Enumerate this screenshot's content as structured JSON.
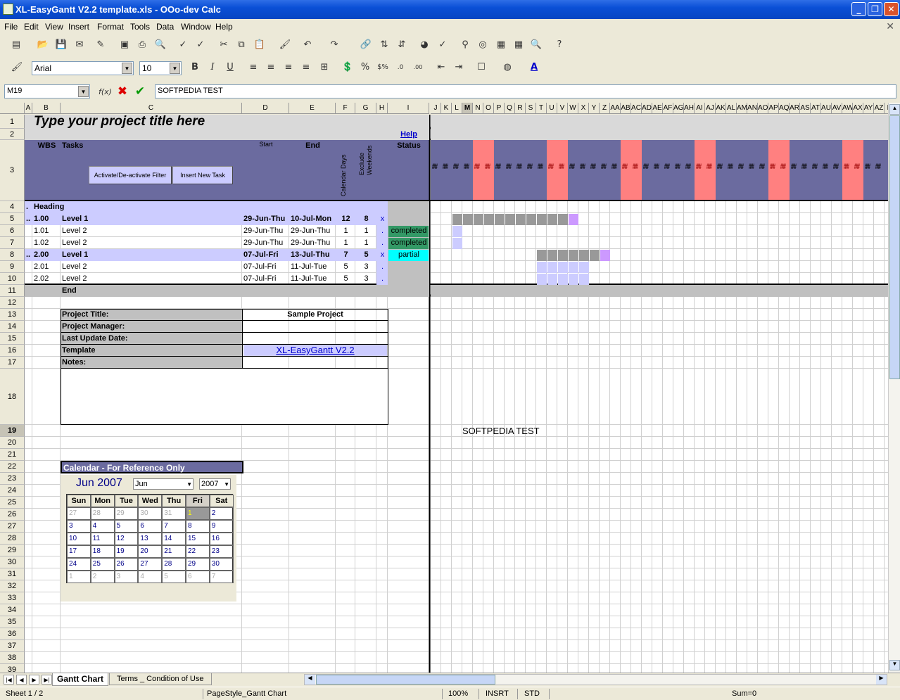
{
  "window": {
    "title": "XL-EasyGantt V2.2 template.xls - OOo-dev Calc"
  },
  "menu": [
    "File",
    "Edit",
    "View",
    "Insert",
    "Format",
    "Tools",
    "Data",
    "Window",
    "Help"
  ],
  "format_bar": {
    "font": "Arial",
    "size": "10"
  },
  "formula": {
    "name_box": "M19",
    "content": "SOFTPEDIA TEST"
  },
  "sheet": {
    "title": "Type your project title here",
    "help": "Help",
    "headers": {
      "wbs": "WBS",
      "tasks": "Tasks",
      "start": "Start",
      "end": "End",
      "calendar_days": "Calendar Days",
      "exclude_weekends": "Exclude Weekends",
      "status": "Status"
    },
    "buttons": {
      "filter": "Activate/De-activate Filter",
      "new_task": "Insert New Task"
    },
    "rows": [
      {
        "a": ".",
        "b": "Heading",
        "c": "",
        "d": "",
        "e": "",
        "f": "",
        "g": "",
        "h": "",
        "i": "",
        "kind": "heading"
      },
      {
        "a": "..",
        "b": "1.00",
        "c": "Level 1",
        "d": "29-Jun-Thu",
        "e": "10-Jul-Mon",
        "f": "12",
        "g": "8",
        "h": "x",
        "i": "",
        "kind": "level1"
      },
      {
        "a": "",
        "b": "1.01",
        "c": "Level 2",
        "d": "29-Jun-Thu",
        "e": "29-Jun-Thu",
        "f": "1",
        "g": "1",
        "h": ".",
        "i": "completed",
        "kind": "level2"
      },
      {
        "a": "",
        "b": "1.02",
        "c": "Level 2",
        "d": "29-Jun-Thu",
        "e": "29-Jun-Thu",
        "f": "1",
        "g": "1",
        "h": ".",
        "i": "completed",
        "kind": "level2"
      },
      {
        "a": "..",
        "b": "2.00",
        "c": "Level 1",
        "d": "07-Jul-Fri",
        "e": "13-Jul-Thu",
        "f": "7",
        "g": "5",
        "h": "x",
        "i": "partial",
        "kind": "level1"
      },
      {
        "a": "",
        "b": "2.01",
        "c": "Level 2",
        "d": "07-Jul-Fri",
        "e": "11-Jul-Tue",
        "f": "5",
        "g": "3",
        "h": ".",
        "i": "",
        "kind": "level2"
      },
      {
        "a": "",
        "b": "2.02",
        "c": "Level 2",
        "d": "07-Jul-Fri",
        "e": "11-Jul-Tue",
        "f": "5",
        "g": "3",
        "h": ".",
        "i": "",
        "kind": "level2"
      }
    ],
    "end_label": "End",
    "info": [
      {
        "label": "Project Title:",
        "value": "Sample Project"
      },
      {
        "label": "Project Manager:",
        "value": ""
      },
      {
        "label": "Last Update Date:",
        "value": ""
      },
      {
        "label": "Template",
        "value": "XL-EasyGantt V2.2"
      },
      {
        "label": "Notes:",
        "value": ""
      }
    ],
    "cell_text": "SOFTPEDIA TEST",
    "calendar": {
      "title": "Calendar - For Reference Only",
      "month_label": "Jun 2007",
      "month_select": "Jun",
      "year_select": "2007",
      "days": [
        "Sun",
        "Mon",
        "Tue",
        "Wed",
        "Thu",
        "Fri",
        "Sat"
      ],
      "weeks": [
        [
          "27",
          "28",
          "29",
          "30",
          "31",
          "1",
          "2"
        ],
        [
          "3",
          "4",
          "5",
          "6",
          "7",
          "8",
          "9"
        ],
        [
          "10",
          "11",
          "12",
          "13",
          "14",
          "15",
          "16"
        ],
        [
          "17",
          "18",
          "19",
          "20",
          "21",
          "22",
          "23"
        ],
        [
          "24",
          "25",
          "26",
          "27",
          "28",
          "29",
          "30"
        ],
        [
          "1",
          "2",
          "3",
          "4",
          "5",
          "6",
          "7"
        ]
      ]
    }
  },
  "col_letters": [
    "A",
    "B",
    "C",
    "D",
    "E",
    "F",
    "G",
    "H",
    "I",
    "J",
    "K",
    "L",
    "M",
    "N",
    "O",
    "P",
    "Q",
    "R",
    "S",
    "T",
    "U",
    "V",
    "W",
    "X",
    "Y",
    "Z",
    "AA",
    "AB",
    "AC",
    "AD",
    "AE",
    "AF",
    "AG",
    "AH",
    "AI",
    "AJ",
    "AK",
    "AL",
    "AM",
    "AN",
    "AO",
    "AP",
    "AQ",
    "AR",
    "AS",
    "AT",
    "AU",
    "AV",
    "AW",
    "AX",
    "AY",
    "AZ",
    "E"
  ],
  "tabs": [
    "Gantt Chart",
    "Terms _ Condition of Use"
  ],
  "status": {
    "sheet": "Sheet 1 / 2",
    "pagestyle": "PageStyle_Gantt Chart",
    "zoom": "100%",
    "mode": "INSRT",
    "sel": "STD",
    "sum": "Sum=0"
  },
  "colors": {
    "header_bg": "#6b6b9f",
    "level1_bg": "#ccccff",
    "weekend": "#ff8080",
    "bar_grey": "#999999",
    "bar_lilac": "#ccccff",
    "bar_purple": "#cc99ff",
    "completed": "#339966",
    "partial": "#00ffff"
  }
}
